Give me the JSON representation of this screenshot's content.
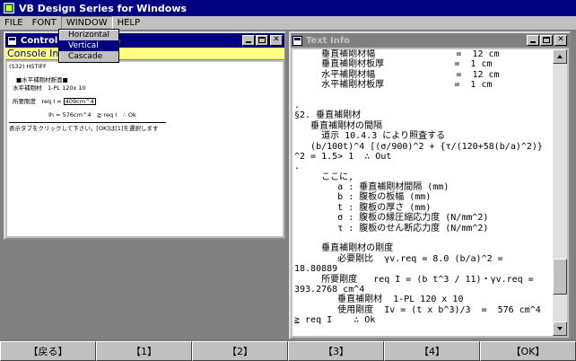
{
  "app": {
    "title": "VB Design Series for Windows"
  },
  "menu": {
    "items": [
      {
        "label": "FILE"
      },
      {
        "label": "FONT"
      },
      {
        "label": "WINDOW"
      },
      {
        "label": "HELP"
      }
    ],
    "window_dropdown": [
      {
        "label": "Horizontal",
        "selected": false
      },
      {
        "label": "Vertical",
        "selected": true
      },
      {
        "label": "Cascade",
        "selected": false
      }
    ]
  },
  "left_window": {
    "title": "Control Information",
    "console_text": "Console Input",
    "content": {
      "header": "(S32) HSTIFF",
      "section_title": "■水平補剛材断面■",
      "member": "水平補剛材　1-PL 120x 10",
      "required_label": "所要剛度　req I = ",
      "required_value": "409cm^4",
      "check_label": "Ih = 576cm^4　≧ req I　∴ Ok",
      "instruction": "表示タブをクリックして下さい。[OK]は[1]を選択します"
    }
  },
  "right_window": {
    "title": "Text Info",
    "lines": [
      "     垂直補剛材幅               =  12 cm",
      "     垂直補剛材板厚             =  1 cm",
      "     水平補剛材幅               =  12 cm",
      "     水平補剛材板厚             =  1 cm",
      "",
      ".",
      "§2. 垂直補剛材",
      "   垂直補剛材の間隔",
      "     道示 10.4.3 により照査する",
      "   (b/100t)^4 [(σ/900)^2 + {τ/(120+58(b/a)^2)}",
      "^2 = 1.5> 1  ∴ Out",
      ".",
      "     ここに,",
      "        a : 垂直補剛材間隔 (mm)",
      "        b : 腹板の板幅 (mm)",
      "        t : 腹板の厚さ (mm)",
      "        σ : 腹板の縁圧縮応力度 (N/mm^2)",
      "        τ : 腹板のせん断応力度 (N/mm^2)",
      "",
      "     垂直補剛材の剛度",
      "        必要剛比  γv.req = 8.0 (b/a)^2 =",
      "18.80889",
      "     所要剛度   req I = (b t^3 / 11)・γv.req =",
      "393.2768 cm^4",
      "        垂直補剛材  1-PL 120 x 10",
      "        使用剛度  Iv = (t x b^3)/3  =  576 cm^4",
      "≧ req I    ∴ Ok"
    ],
    "scroll_fraction": 0.88
  },
  "fkeys": [
    {
      "label": "【戻る】"
    },
    {
      "label": "【1】"
    },
    {
      "label": "【2】"
    },
    {
      "label": "【3】"
    },
    {
      "label": "【4】"
    },
    {
      "label": "【OK】"
    }
  ]
}
